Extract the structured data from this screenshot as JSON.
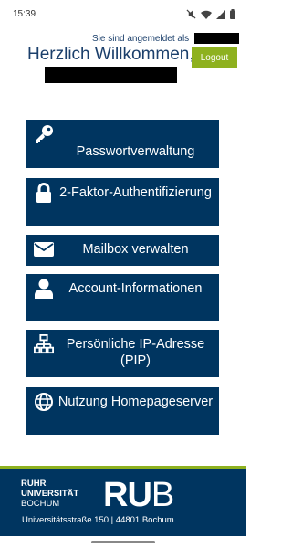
{
  "statusbar": {
    "time": "15:39",
    "icons": [
      "mute-icon",
      "wifi-icon",
      "signal-icon",
      "battery-icon"
    ]
  },
  "header": {
    "logged_in_text": "Sie sind angemeldet als",
    "welcome": "Herzlich Willkommen,",
    "logout_label": "Logout"
  },
  "menu": [
    {
      "id": "password",
      "icon": "key-icon",
      "label": "Passwortverwaltung"
    },
    {
      "id": "2fa",
      "icon": "lock-icon",
      "label": "2-Faktor-Authentifizierung"
    },
    {
      "id": "mailbox",
      "icon": "envelope-icon",
      "label": "Mailbox verwalten"
    },
    {
      "id": "account",
      "icon": "user-icon",
      "label": "Account-Informationen"
    },
    {
      "id": "pip",
      "icon": "network-icon",
      "label": "Persönliche IP-Adresse (PIP)"
    },
    {
      "id": "homepage",
      "icon": "globe-icon",
      "label": "Nutzung Homepageserver"
    }
  ],
  "footer": {
    "uni_line1": "RUHR",
    "uni_line2": "UNIVERSITÄT",
    "uni_line3": "BOCHUM",
    "logo_ru": "RU",
    "logo_b": "B",
    "address": "Universitätsstraße 150 | 44801 Bochum"
  },
  "colors": {
    "primary": "#003560",
    "accent": "#8eb11f",
    "text": "#1b3f6b"
  }
}
